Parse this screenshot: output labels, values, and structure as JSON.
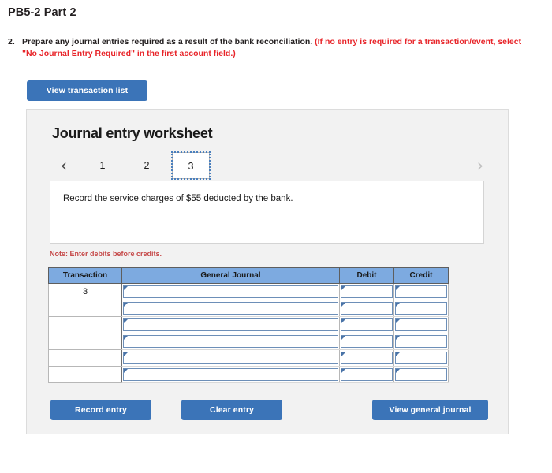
{
  "page_title": "PB5-2 Part 2",
  "question": {
    "number": "2.",
    "text_black": "Prepare any journal entries required as a result of the bank reconciliation. ",
    "text_red": "(If no entry is required for a transaction/event, select \"No Journal Entry Required\" in the first account field.)"
  },
  "toolbar": {
    "view_transaction_list_label": "View transaction list"
  },
  "worksheet": {
    "title": "Journal entry worksheet",
    "pager": {
      "prev_icon": "chevron-left-icon",
      "next_icon": "chevron-right-icon",
      "prev_glyph": "‹",
      "next_glyph": "›",
      "tabs": [
        {
          "label": "1",
          "active": false
        },
        {
          "label": "2",
          "active": false
        },
        {
          "label": "3",
          "active": true
        }
      ],
      "active_tab": "3"
    },
    "description": "Record the service charges of $55 deducted by the bank.",
    "note": "Note: Enter debits before credits."
  },
  "table": {
    "headers": [
      "Transaction",
      "General Journal",
      "Debit",
      "Credit"
    ],
    "rows": [
      {
        "transaction": "3",
        "general_journal": "",
        "debit": "",
        "credit": ""
      },
      {
        "transaction": "",
        "general_journal": "",
        "debit": "",
        "credit": ""
      },
      {
        "transaction": "",
        "general_journal": "",
        "debit": "",
        "credit": ""
      },
      {
        "transaction": "",
        "general_journal": "",
        "debit": "",
        "credit": ""
      },
      {
        "transaction": "",
        "general_journal": "",
        "debit": "",
        "credit": ""
      },
      {
        "transaction": "",
        "general_journal": "",
        "debit": "",
        "credit": ""
      }
    ]
  },
  "actions": {
    "record_entry_label": "Record entry",
    "clear_entry_label": "Clear entry",
    "view_general_journal_label": "View general journal"
  },
  "colors": {
    "button_blue": "#3b74b8",
    "table_header_blue": "#7daae0",
    "panel_bg": "#f2f2f2",
    "alert_red": "#e8252a",
    "note_red": "#c64b4b",
    "input_border_blue": "#6d8fb8"
  }
}
